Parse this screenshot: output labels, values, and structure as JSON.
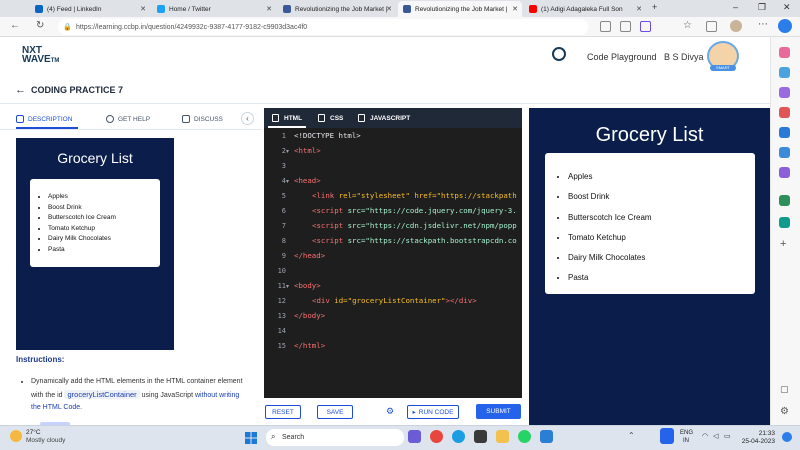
{
  "browser": {
    "tabs": [
      {
        "label": "(4) Feed | LinkedIn",
        "color": "#0a66c2"
      },
      {
        "label": "Home / Twitter",
        "color": "#1da1f2"
      },
      {
        "label": "Revolutionizing the Job Market |",
        "color": "#3b5998"
      },
      {
        "label": "Revolutionizing the Job Market |",
        "color": "#3b5998"
      },
      {
        "label": "(1) Adigi Adagaleka Full Son",
        "color": "#ff0000"
      }
    ],
    "url": "https://learning.ccbp.in/question/4249932c-9387-4177-9182-c9903d3ac4f0"
  },
  "site": {
    "logo_line1": "NXT",
    "logo_line2": "WAVE",
    "logo_tm": "TM",
    "code_playground": "Code Playground",
    "user_name": "B S Divya",
    "badge": "SMART"
  },
  "practice": {
    "title": "CODING PRACTICE 7"
  },
  "left_tabs": {
    "description": "DESCRIPTION",
    "get_help": "GET HELP",
    "discuss": "DISCUSS"
  },
  "preview": {
    "title": "Grocery List",
    "items": [
      "Apples",
      "Boost Drink",
      "Butterscotch Ice Cream",
      "Tomato Ketchup",
      "Dairy Milk Chocolates",
      "Pasta"
    ]
  },
  "instructions": {
    "heading": "Instructions:",
    "text_before_id": "Dynamically add the HTML elements in the HTML container element with the id",
    "code_id": "groceryListContainer",
    "text_using": "using",
    "text_js": "JavaScript",
    "text_emphasis": "without writing the HTML Code."
  },
  "editor": {
    "tabs": {
      "html": "HTML",
      "css": "CSS",
      "js": "JAVASCRIPT"
    },
    "line_numbers": [
      "1",
      "2",
      "3",
      "4",
      "5",
      "6",
      "7",
      "8",
      "9",
      "10",
      "11",
      "12",
      "13",
      "14",
      "15"
    ],
    "lines": {
      "l1": "<!DOCTYPE html>",
      "l2": "<html>",
      "l4": "<head>",
      "l5_attr": "rel=\"stylesheet\" href=\"https://stackpath",
      "l6": "src=\"https://code.jquery.com/jquery-3.",
      "l7": "src=\"https://cdn.jsdelivr.net/npm/popp",
      "l8": "src=\"https://stackpath.bootstrapcdn.co",
      "l9": "</head>",
      "l11": "<body>",
      "l12": "id=\"groceryListContainer\"",
      "l13": "</body>",
      "l15": "</html>"
    },
    "buttons": {
      "reset": "RESET",
      "save": "SAVE",
      "run": "RUN CODE",
      "submit": "SUBMIT"
    }
  },
  "output": {
    "title": "Grocery List",
    "items": [
      "Apples",
      "Boost Drink",
      "Butterscotch Ice Cream",
      "Tomato Ketchup",
      "Dairy Milk Chocolates",
      "Pasta"
    ]
  },
  "taskbar": {
    "temp": "27°C",
    "weather": "Mostly cloudy",
    "search": "Search",
    "lang1": "ENG",
    "lang2": "IN",
    "time": "21:33",
    "date": "25-04-2023"
  },
  "colors": {
    "navy": "#0b1e4b",
    "accent": "#1d4ed8",
    "editor_bg": "#1e1e1e"
  }
}
